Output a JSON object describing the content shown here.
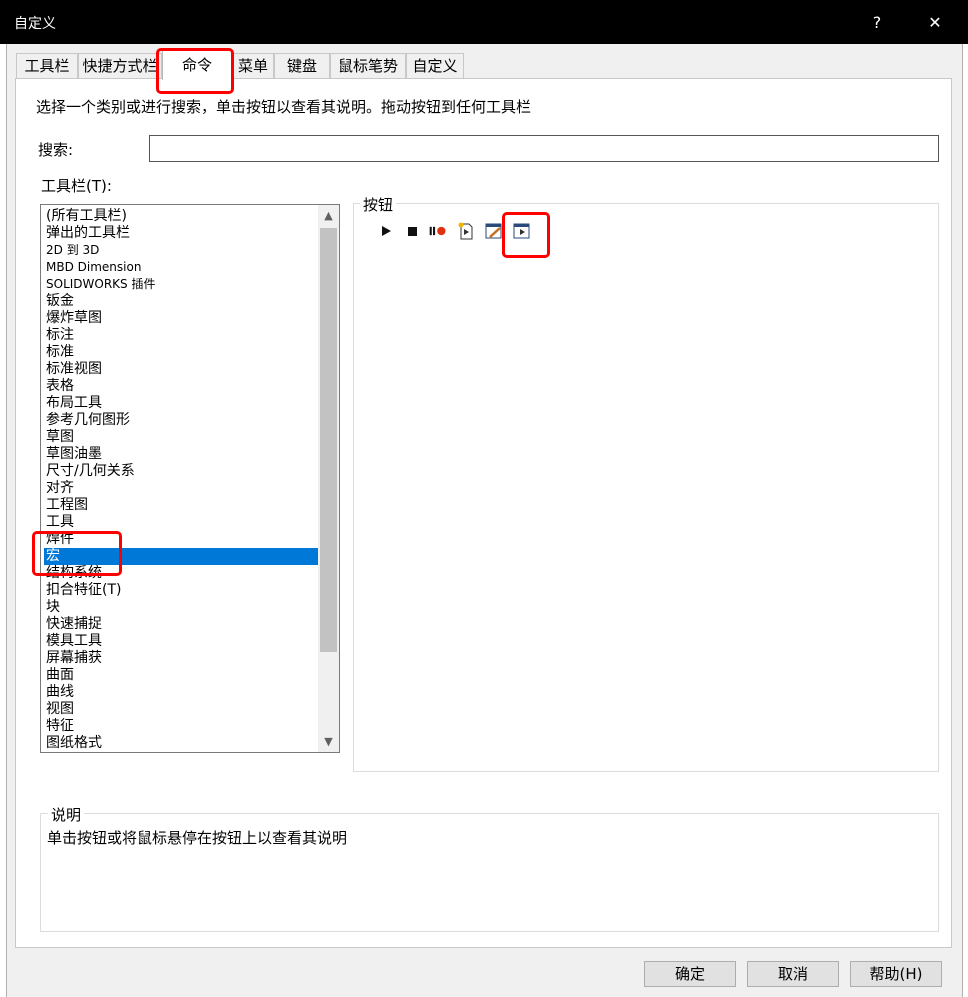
{
  "window": {
    "title": "自定义",
    "help_glyph": "?",
    "close_glyph": "✕"
  },
  "tabs": [
    {
      "label": "工具栏"
    },
    {
      "label": "快捷方式栏"
    },
    {
      "label": "命令"
    },
    {
      "label": "菜单"
    },
    {
      "label": "键盘"
    },
    {
      "label": "鼠标笔势"
    },
    {
      "label": "自定义"
    }
  ],
  "active_tab": "命令",
  "instructions": "选择一个类别或进行搜索，单击按钮以查看其说明。拖动按钮到任何工具栏",
  "search": {
    "label": "搜索:",
    "value": ""
  },
  "toolbars": {
    "label": "工具栏(T):",
    "selected": "宏",
    "items": [
      "(所有工具栏)",
      "弹出的工具栏",
      "2D 到 3D",
      "MBD Dimension",
      "SOLIDWORKS 插件",
      "钣金",
      "爆炸草图",
      "标注",
      "标准",
      "标准视图",
      "表格",
      "布局工具",
      "参考几何图形",
      "草图",
      "草图油墨",
      "尺寸/几何关系",
      "对齐",
      "工程图",
      "工具",
      "焊件",
      "宏",
      "结构系统",
      "扣合特征(T)",
      "块",
      "快速捕捉",
      "模具工具",
      "屏幕捕获",
      "曲面",
      "曲线",
      "视图",
      "特征",
      "图纸格式"
    ],
    "scroll_up": "▲",
    "scroll_down": "▼"
  },
  "buttons_group": {
    "label": "按钮",
    "icons": [
      "play-macro-icon",
      "stop-macro-icon",
      "pause-record-macro-icon",
      "new-macro-icon",
      "edit-macro-icon",
      "custom-macro-icon"
    ]
  },
  "description": {
    "label": "说明",
    "text": "单击按钮或将鼠标悬停在按钮上以查看其说明"
  },
  "footer": {
    "ok": "确定",
    "cancel": "取消",
    "help": "帮助(H)"
  },
  "colors": {
    "selection": "#0078d7",
    "annotation": "#ff0000",
    "record": "#e03010"
  }
}
